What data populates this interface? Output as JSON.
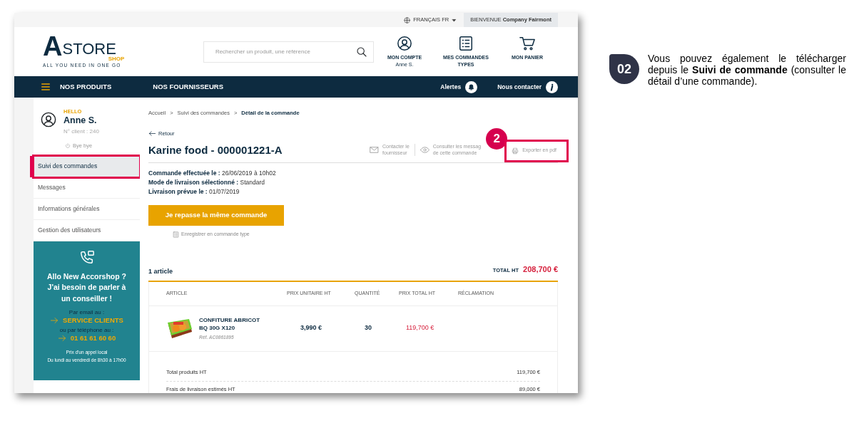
{
  "top_bar": {
    "language": "FRANÇAIS FR",
    "welcome": "BIENVENUE **Company Fairmont**"
  },
  "header": {
    "logo": {
      "mark": "A",
      "name": "STORE",
      "sub": "SHOP",
      "tagline": "ALL YOU NEED IN ONE GO"
    },
    "search": {
      "placeholder": "Rechercher un produit, une référence"
    },
    "actions": [
      {
        "label": "MON COMPTE",
        "sub": "Anne S.",
        "kind": "account"
      },
      {
        "label": "MES COMMANDES TYPES",
        "kind": "list"
      },
      {
        "label": "MON PANIER",
        "kind": "cart"
      }
    ]
  },
  "nav": {
    "items": [
      "NOS PRODUITS",
      "NOS FOURNISSEURS"
    ],
    "right": [
      {
        "label": "Alertes",
        "kind": "bell"
      },
      {
        "label": "Nous contacter",
        "kind": "info"
      }
    ]
  },
  "profile": {
    "greeting": "HELLO",
    "name": "Anne S.",
    "client": "N° client : 240",
    "logout": "Bye bye"
  },
  "sidebar": {
    "items": [
      {
        "label": "Suivi des commandes",
        "selected": true,
        "highlighted": true
      },
      {
        "label": "Messages",
        "selected": false,
        "highlighted": false
      },
      {
        "label": "Informations générales",
        "selected": false,
        "highlighted": false
      },
      {
        "label": "Gestion des utilisateurs",
        "selected": false,
        "highlighted": false
      }
    ]
  },
  "help_box": {
    "title": "Allo New Accorshop ? J'ai besoin de parler à un conseiller !",
    "email_label": "Par email au :",
    "email_link": "SERVICE CLIENTS",
    "phone_label": "ou par téléphone au :",
    "phone": "01 61 61 60 60",
    "notes": [
      "Prix d'un appel local",
      "Du lundi au vendredi de 8h30 à 17h00"
    ]
  },
  "breadcrumb": {
    "separator": ">",
    "items": [
      {
        "label": "Accueil",
        "current": false
      },
      {
        "label": "Suivi des commandes",
        "current": false
      },
      {
        "label": "Détail de la commande",
        "current": true
      }
    ]
  },
  "back": "Retour",
  "order": {
    "title": "Karine food - 000001221-A",
    "actions": [
      {
        "label": "Contacter le\nfournisseur",
        "kind": "mail",
        "highlighted": false
      },
      {
        "label": "Consulter les messag\nde cette commande",
        "kind": "eye",
        "highlighted": false
      },
      {
        "label": "Exporter en pdf",
        "kind": "print",
        "highlighted": true,
        "badge": "2"
      }
    ],
    "details": [
      "**Commande effectuée le :** 26/06/2019 à 10h02",
      "**Mode de livraison sélectionné :** Standard",
      "**Livraison prévue le :** 01/07/2019"
    ],
    "reorder_button": "Je repasse la même commande",
    "save_link": "Enregistrer en commande type"
  },
  "summary": {
    "count": "1 article",
    "total_label": "TOTAL HT",
    "total": "208,700 €"
  },
  "table": {
    "columns": [
      "ARTICLE",
      "PRIX UNITAIRE HT",
      "QUANTITÉ",
      "PRIX TOTAL HT",
      "RÉCLAMATION"
    ],
    "rows": [
      {
        "name": "CONFITURE ABRICOT BQ 30G X120",
        "ref": "Réf. AC0861895",
        "unit_price": "3,990 €",
        "quantity": "30",
        "total": "119,700 €"
      }
    ]
  },
  "totals": [
    {
      "label": "Total produits HT",
      "value": "119,700 €"
    },
    {
      "label": "Frais de livraison estimés HT",
      "value": "89,000 €"
    }
  ],
  "callout": {
    "number": "02",
    "text": "Vous pouvez également le télécharger depuis le **Suivi de commande** (consulter le détail d’une commande)."
  }
}
